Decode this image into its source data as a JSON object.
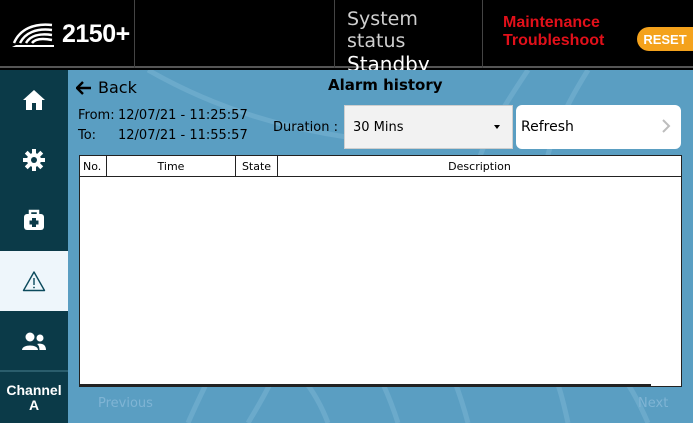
{
  "header": {
    "logo_text": "2150+",
    "system_status_title": "System status",
    "system_status_value": "Standby",
    "mode_line1": "Maintenance",
    "mode_line2": "Troubleshoot",
    "reset_label": "RESET",
    "colors": {
      "mode": "#e2101a",
      "reset": "#f4a21c"
    }
  },
  "sidebar": {
    "items": [
      {
        "icon": "home-icon"
      },
      {
        "icon": "gear-icon"
      },
      {
        "icon": "toolbox-icon"
      },
      {
        "icon": "warning-icon",
        "active": true
      },
      {
        "icon": "users-icon"
      }
    ],
    "channel_label": "Channel",
    "channel_value": "A"
  },
  "main": {
    "back_label": "Back",
    "title": "Alarm history",
    "from_label": "From:",
    "from_value": "12/07/21 - 11:25:57",
    "to_label": "To:",
    "to_value": "12/07/21 - 11:55:57",
    "duration_label": "Duration :",
    "duration_value": "30 Mins",
    "refresh_label": "Refresh",
    "table": {
      "columns": [
        "No.",
        "Time",
        "State",
        "Description"
      ],
      "rows": []
    },
    "prev_label": "Previous",
    "next_label": "Next"
  }
}
